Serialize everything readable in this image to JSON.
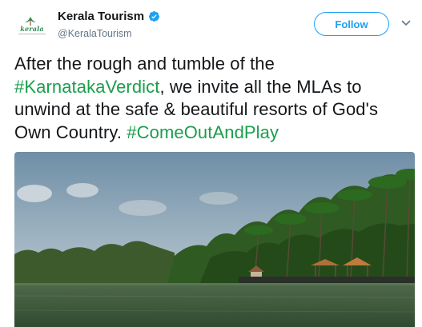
{
  "tweet": {
    "display_name": "Kerala Tourism",
    "handle": "@KeralaTourism",
    "follow_label": "Follow",
    "avatar_logo_text": "kerala",
    "text_parts": {
      "p1": "After the rough and tumble of the ",
      "hashtag1": "#KarnatakaVerdict",
      "p2": ", we invite all the MLAs to unwind at the safe & beautiful resorts of God's Own Country. ",
      "hashtag2": "#ComeOutAndPlay"
    },
    "icons": {
      "verified": "verified-badge-icon",
      "more": "chevron-down-icon"
    },
    "colors": {
      "hashtag": "#1a9e4b",
      "follow": "#1da1f2",
      "verified": "#1da1f2"
    }
  }
}
